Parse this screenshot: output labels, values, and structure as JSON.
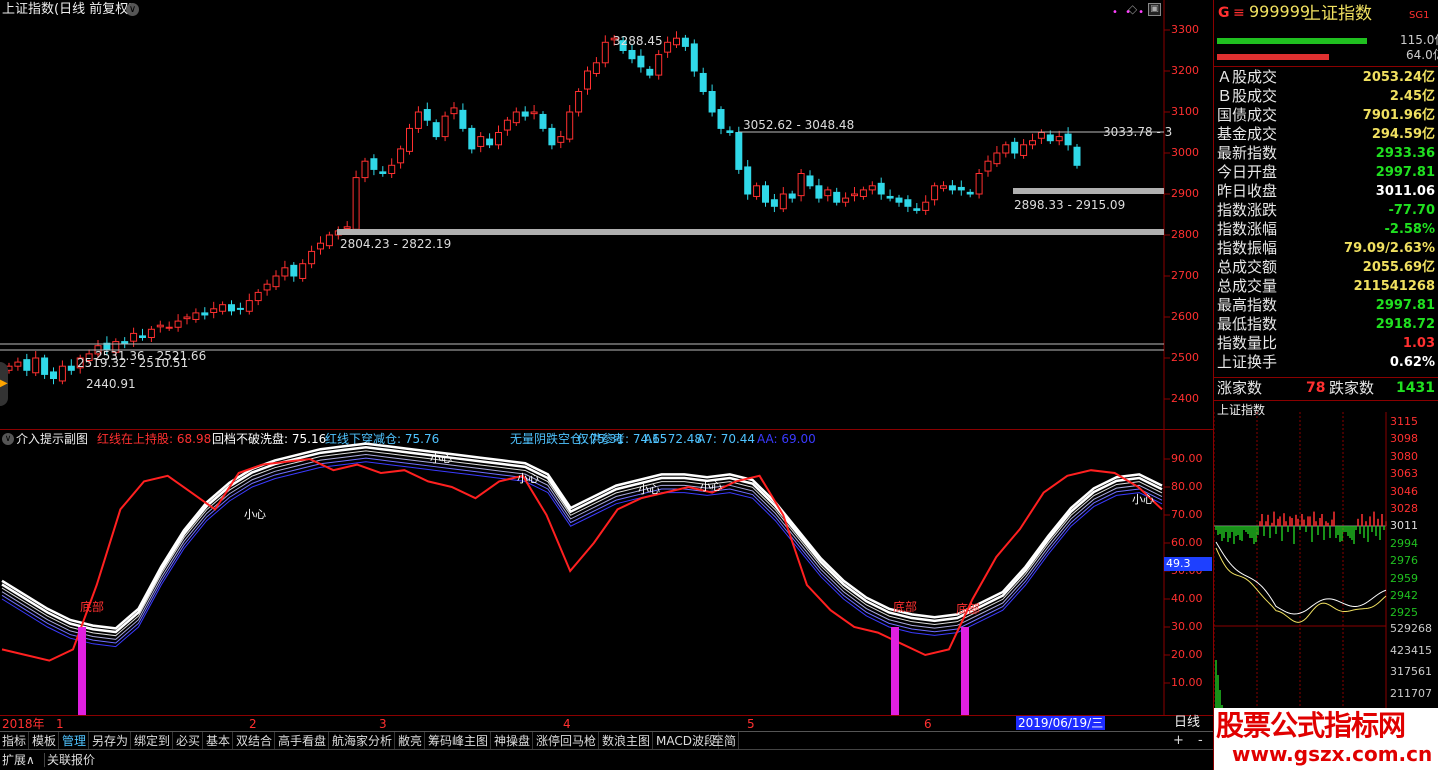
{
  "main_chart": {
    "title": "上证指数(日线 前复权)",
    "y_ticks": [
      "3300",
      "3200",
      "3100",
      "3000",
      "2900",
      "2800",
      "2700",
      "2600",
      "2500",
      "2400"
    ],
    "labels": {
      "high": "3288.45",
      "level1": "3052.62 - 3048.48",
      "level2": "3033.78 - 3",
      "level3": "2898.33 - 2915.09",
      "level4": "2804.23 - 2822.19",
      "level5": "2531.36 - 2521.66",
      "level6": "2519.32 - 2510.51",
      "low": "2440.91"
    }
  },
  "indicator": {
    "title": "介入提示副图",
    "legend": [
      {
        "text": "红线在上持股: 68.98",
        "color": "#ff3030"
      },
      {
        "text": "回档不破洗盘: 75.16",
        "color": "#ffffff"
      },
      {
        "text": "红线下穿减仓: 75.76",
        "color": "#4fc3ff"
      },
      {
        "text": "无量阴跌空仓: 75.31",
        "color": "#4fc3ff"
      },
      {
        "text": "仅供参考: 74.15",
        "color": "#4fc3ff"
      },
      {
        "text": "A6: 72.48",
        "color": "#4fc3ff"
      },
      {
        "text": "A7: 70.44",
        "color": "#4fc3ff"
      },
      {
        "text": "AA: 69.00",
        "color": "#3a3aff"
      }
    ],
    "y_ticks": [
      "90.00",
      "80.00",
      "70.00",
      "60.00",
      "50.00",
      "40.00",
      "30.00",
      "20.00",
      "10.00"
    ],
    "current_value": "49.3",
    "annotations": {
      "bottom": "底部",
      "caution": "小心"
    }
  },
  "x_axis": {
    "year_label": "2018年",
    "months": [
      "1",
      "2",
      "3",
      "4",
      "5",
      "6"
    ],
    "date_highlight": "2019/06/19/三",
    "period": "日线"
  },
  "toolbar": [
    "指标",
    "模板",
    "管理",
    "另存为",
    "绑定到",
    "必买",
    "基本",
    "双结合",
    "高手看盘",
    "航海家分析",
    "敝亮",
    "筹码峰主图",
    "神操盘",
    "涨停回马枪",
    "数浪主图",
    "MACD波段",
    "至简"
  ],
  "toolbar_active": "管理",
  "status": {
    "expand": "扩展∧",
    "related": "关联报价",
    "plus": "+",
    "minus": "-"
  },
  "right_panel": {
    "flag": "G",
    "code": "999999",
    "name": "上证指数",
    "badge": "SG1",
    "volume_bars": [
      "115.0亿",
      "64.0亿"
    ],
    "stats": [
      {
        "label": "Ａ股成交",
        "value": "2053.24亿",
        "color": "yel"
      },
      {
        "label": "Ｂ股成交",
        "value": "2.45亿",
        "color": "yel"
      },
      {
        "label": "国债成交",
        "value": "7901.96亿",
        "color": "yel"
      },
      {
        "label": "基金成交",
        "value": "294.59亿",
        "color": "yel"
      },
      {
        "label": "最新指数",
        "value": "2933.36",
        "color": "grn"
      },
      {
        "label": "今日开盘",
        "value": "2997.81",
        "color": "grn"
      },
      {
        "label": "昨日收盘",
        "value": "3011.06",
        "color": "wht"
      },
      {
        "label": "指数涨跌",
        "value": "-77.70",
        "color": "grn"
      },
      {
        "label": "指数涨幅",
        "value": "-2.58%",
        "color": "grn"
      },
      {
        "label": "指数振幅",
        "value": "79.09/2.63%",
        "color": "yel"
      },
      {
        "label": "总成交额",
        "value": "2055.69亿",
        "color": "yel"
      },
      {
        "label": "总成交量",
        "value": "211541268",
        "color": "yel"
      },
      {
        "label": "最高指数",
        "value": "2997.81",
        "color": "grn"
      },
      {
        "label": "最低指数",
        "value": "2918.72",
        "color": "grn"
      },
      {
        "label": "指数量比",
        "value": "1.03",
        "color": "red"
      },
      {
        "label": "上证换手",
        "value": "0.62%",
        "color": "wht"
      }
    ],
    "rise_label": "涨家数",
    "rise_count": "78",
    "fall_label": "跌家数",
    "fall_count": "1431",
    "mini_title": "上证指数",
    "mini_ticks": [
      "3115",
      "3098",
      "3080",
      "3063",
      "3046",
      "3028",
      "3011",
      "2994",
      "2976",
      "2959",
      "2942",
      "2925",
      "529268",
      "423415",
      "317561",
      "211707"
    ],
    "watermark": "股票公式指标网",
    "watermark_url": "www.gszx.com.cn"
  }
}
